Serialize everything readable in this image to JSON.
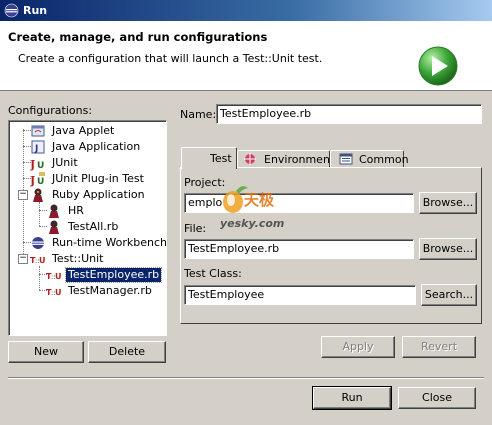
{
  "window": {
    "title": "Run"
  },
  "header": {
    "title": "Create, manage, and run configurations",
    "subtitle": "Create a configuration that will launch a Test::Unit test."
  },
  "configurations": {
    "label": "Configurations:",
    "items": [
      {
        "label": "Java Applet",
        "icon": "java-applet-icon"
      },
      {
        "label": "Java Application",
        "icon": "java-application-icon"
      },
      {
        "label": "JUnit",
        "icon": "junit-icon"
      },
      {
        "label": "JUnit Plug-in Test",
        "icon": "junit-plugin-icon"
      },
      {
        "label": "Ruby Application",
        "icon": "ruby-icon",
        "expanded": true
      },
      {
        "label": "HR",
        "icon": "ruby-config-icon"
      },
      {
        "label": "TestAll.rb",
        "icon": "ruby-config-icon"
      },
      {
        "label": "Run-time Workbench",
        "icon": "workbench-icon"
      },
      {
        "label": "Test::Unit",
        "icon": "test-unit-icon",
        "expanded": true
      },
      {
        "label": "TestEmployee.rb",
        "icon": "test-unit-config-icon",
        "selected": true
      },
      {
        "label": "TestManager.rb",
        "icon": "test-unit-config-icon"
      }
    ]
  },
  "buttons": {
    "new": "New",
    "delete": "Delete",
    "apply": "Apply",
    "revert": "Revert",
    "run": "Run",
    "close": "Close",
    "browse_project": "Browse...",
    "browse_file": "Browse...",
    "search": "Search..."
  },
  "name_field": {
    "label": "Name:",
    "value": "TestEmployee.rb"
  },
  "tabs": [
    {
      "label": "Test",
      "active": true
    },
    {
      "label": "Environment"
    },
    {
      "label": "Common"
    }
  ],
  "form": {
    "project_label": "Project:",
    "project_value": "emplo",
    "file_label": "File:",
    "file_value": "TestEmployee.rb",
    "class_label": "Test Class:",
    "class_value": "TestEmployee"
  },
  "watermark": {
    "brand": "天极",
    "site": "yesky.com"
  },
  "colors": {
    "title_bar": "#0a246a",
    "selection": "#0a246a",
    "run_icon": "#3fa83a"
  }
}
